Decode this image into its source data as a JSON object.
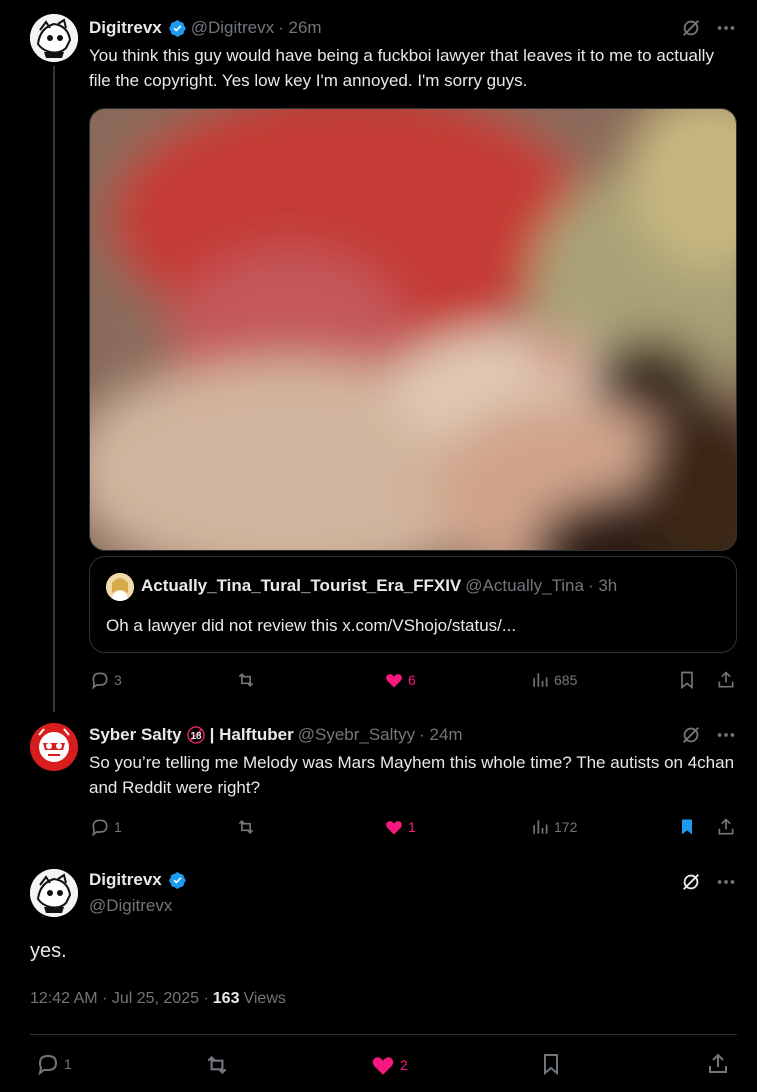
{
  "tweet1": {
    "display_name": "Digitrevx",
    "handle": "@Digitrevx",
    "time": "· 26m",
    "text": "You think this guy would have being a fuckboi lawyer that leaves it to me to actually file the copyright. Yes low key I'm annoyed. I'm sorry guys.",
    "quote": {
      "display_name": "Actually_Tina_Tural_Tourist_Era_FFXIV",
      "handle": "@Actually_Tina",
      "time": "· 3h",
      "text": "Oh a lawyer did not review this x.com/VShojo/status/..."
    },
    "replies": "3",
    "reposts": "",
    "likes": "6",
    "views": "685"
  },
  "tweet2": {
    "display_name": "Syber Salty",
    "name_suffix": "| Halftuber",
    "handle": "@Syebr_Saltyy",
    "time": "· 24m",
    "text": "So you’re telling me Melody was Mars Mayhem this whole time? The autists on 4chan and Reddit were right?",
    "replies": "1",
    "likes": "1",
    "views": "172"
  },
  "main_tweet": {
    "display_name": "Digitrevx",
    "handle": "@Digitrevx",
    "text": "yes.",
    "timestamp": "12:42 AM · Jul 25, 2025 ·",
    "views_count": "163",
    "views_label": "Views",
    "replies": "1",
    "likes": "2"
  },
  "colors": {
    "background": "#000000",
    "verified": "#1d9bf0",
    "like_active": "#f91880",
    "bookmark_active": "#1d9bf0",
    "muted_text": "#71767b"
  },
  "icons": [
    "verified-badge-icon",
    "grok-icon",
    "more-icon",
    "reply-icon",
    "repost-icon",
    "like-icon",
    "views-icon",
    "bookmark-icon",
    "share-icon"
  ]
}
